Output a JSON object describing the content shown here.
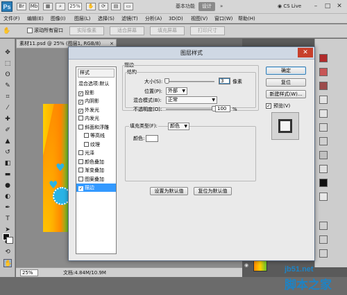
{
  "app": {
    "logo": "Ps",
    "zoom": "25%",
    "workspace": {
      "basic": "基本功能",
      "design": "设计",
      "more": "»"
    },
    "cs_live": "CS Live",
    "window_controls": [
      "–",
      "□",
      "✕"
    ]
  },
  "menu": [
    "文件(F)",
    "编辑(E)",
    "图像(I)",
    "图层(L)",
    "选择(S)",
    "滤镜(T)",
    "分析(A)",
    "3D(D)",
    "视图(V)",
    "窗口(W)",
    "帮助(H)"
  ],
  "options_bar": {
    "scroll_all": "滚动所有窗口",
    "buttons": [
      "实际像素",
      "适合屏幕",
      "填充屏幕",
      "打印尺寸"
    ]
  },
  "document": {
    "tab": "素材11.psd @ 25% (图层1, RGB/8)",
    "tab_close": "×",
    "zoom": "25%",
    "info": "文档:4.84M/10.9M"
  },
  "dialog": {
    "title": "图层样式",
    "close": "✕",
    "styles_header": "样式",
    "styles": [
      {
        "label": "混合选项:默认",
        "checkbox": false,
        "checked": false,
        "sub": false,
        "selected": false
      },
      {
        "label": "投影",
        "checkbox": true,
        "checked": true,
        "sub": false,
        "selected": false
      },
      {
        "label": "内阴影",
        "checkbox": true,
        "checked": true,
        "sub": false,
        "selected": false
      },
      {
        "label": "外发光",
        "checkbox": true,
        "checked": true,
        "sub": false,
        "selected": false
      },
      {
        "label": "内发光",
        "checkbox": true,
        "checked": false,
        "sub": false,
        "selected": false
      },
      {
        "label": "斜面和浮雕",
        "checkbox": true,
        "checked": false,
        "sub": false,
        "selected": false
      },
      {
        "label": "等高线",
        "checkbox": true,
        "checked": false,
        "sub": true,
        "selected": false
      },
      {
        "label": "纹理",
        "checkbox": true,
        "checked": false,
        "sub": true,
        "selected": false
      },
      {
        "label": "光泽",
        "checkbox": true,
        "checked": false,
        "sub": false,
        "selected": false
      },
      {
        "label": "颜色叠加",
        "checkbox": true,
        "checked": false,
        "sub": false,
        "selected": false
      },
      {
        "label": "渐变叠加",
        "checkbox": true,
        "checked": false,
        "sub": false,
        "selected": false
      },
      {
        "label": "图案叠加",
        "checkbox": true,
        "checked": false,
        "sub": false,
        "selected": false
      },
      {
        "label": "描边",
        "checkbox": true,
        "checked": true,
        "sub": false,
        "selected": true
      }
    ],
    "stroke": {
      "title": "描边",
      "structure_title": "结构",
      "size_label": "大小(S):",
      "size_value": "3",
      "size_unit": "像素",
      "size_slider_value": 0.02,
      "position_label": "位置(P):",
      "position_value": "外部",
      "blend_label": "混合模式(B):",
      "blend_value": "正常",
      "opacity_label": "不透明度(O):",
      "opacity_value": "100",
      "opacity_unit": "%",
      "opacity_slider_value": 1.0,
      "fill_type_label": "填充类型(F):",
      "fill_type_value": "颜色",
      "color_label": "颜色:",
      "color_value": "#ffffff",
      "set_default": "设置为默认值",
      "reset_default": "复位为默认值"
    },
    "buttons": {
      "ok": "确定",
      "reset": "复位",
      "new_style": "新建样式(W)...",
      "preview_label": "预览(V)",
      "preview_checked": true
    }
  },
  "watermark": {
    "site": "jb51.net",
    "name": "脚本之家"
  },
  "colors": {
    "selection": "#3399ff",
    "ok_border": "#3c7fb1",
    "close_red": "#c7402c",
    "watermark_blue": "#1d83c5"
  }
}
